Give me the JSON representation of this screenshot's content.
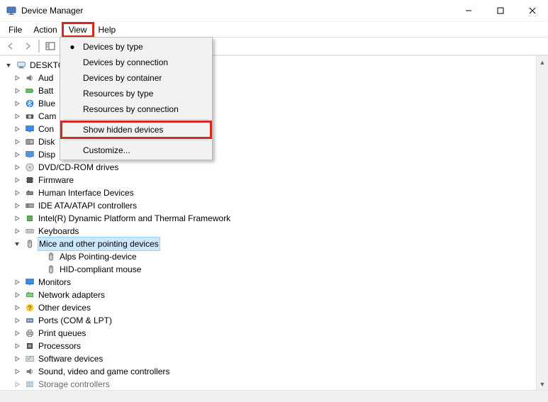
{
  "window": {
    "title": "Device Manager"
  },
  "menubar": {
    "file": "File",
    "action": "Action",
    "view": "View",
    "help": "Help"
  },
  "dropdown": {
    "devices_by_type": "Devices by type",
    "devices_by_connection": "Devices by connection",
    "devices_by_container": "Devices by container",
    "resources_by_type": "Resources by type",
    "resources_by_connection": "Resources by connection",
    "show_hidden_devices": "Show hidden devices",
    "customize": "Customize..."
  },
  "tree": {
    "root": "DESKTO",
    "categories": {
      "aud": "Aud",
      "batt": "Batt",
      "blue": "Blue",
      "cam": "Cam",
      "con": "Con",
      "disk": "Disk",
      "disp": "Disp",
      "dvd": "DVD/CD-ROM drives",
      "firmware": "Firmware",
      "hid": "Human Interface Devices",
      "ide": "IDE ATA/ATAPI controllers",
      "intel_dptf": "Intel(R) Dynamic Platform and Thermal Framework",
      "keyboards": "Keyboards",
      "mice": "Mice and other pointing devices",
      "monitors": "Monitors",
      "network": "Network adapters",
      "other": "Other devices",
      "ports": "Ports (COM & LPT)",
      "print_queues": "Print queues",
      "processors": "Processors",
      "software": "Software devices",
      "sound": "Sound, video and game controllers",
      "storage": "Storage controllers"
    },
    "mice_children": {
      "alps": "Alps Pointing-device",
      "hid_mouse": "HID-compliant mouse"
    }
  }
}
